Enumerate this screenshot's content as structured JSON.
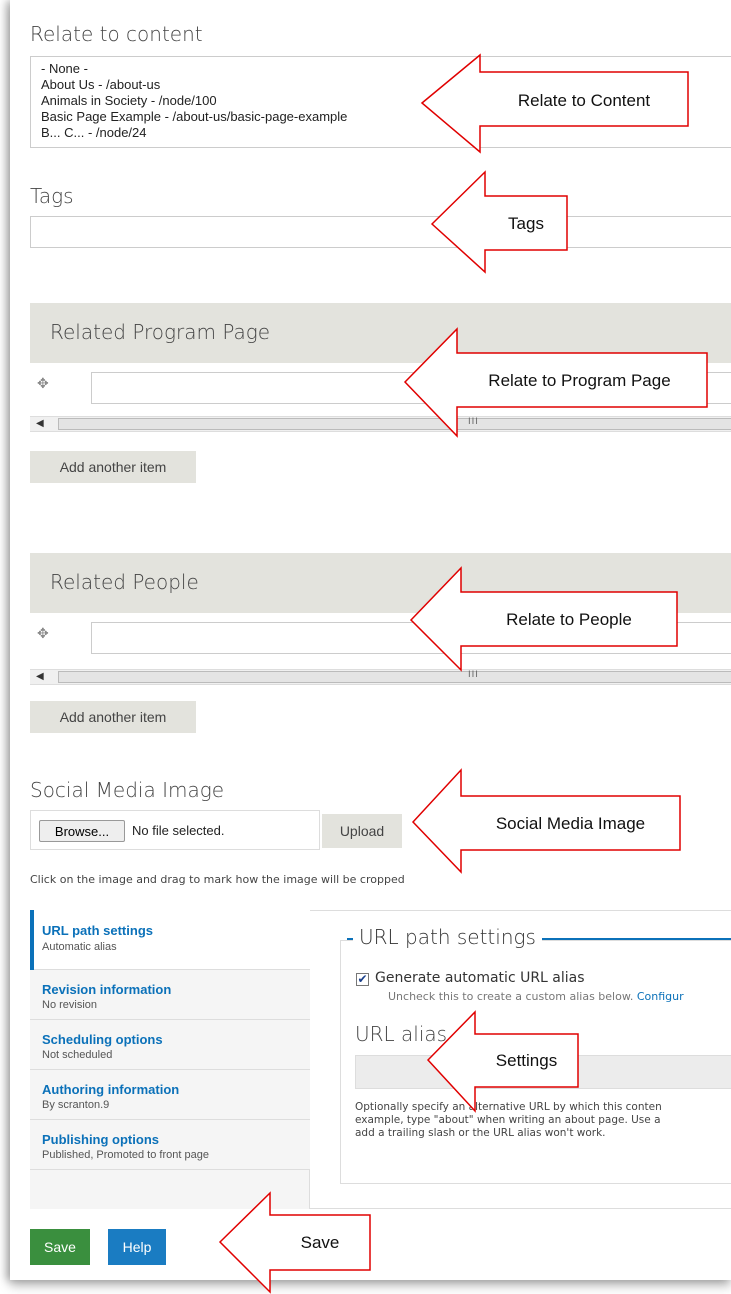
{
  "relate": {
    "label": "Relate to content",
    "options": [
      "- None -",
      "About Us - /about-us",
      "Animals in Society - /node/100",
      "Basic Page Example - /about-us/basic-page-example",
      "B... C... - /node/24"
    ]
  },
  "tags": {
    "label": "Tags",
    "value": ""
  },
  "program": {
    "title": "Related Program Page",
    "add_label": "Add another item",
    "value": ""
  },
  "people": {
    "title": "Related People",
    "add_label": "Add another item",
    "value": ""
  },
  "social": {
    "label": "Social Media Image",
    "browse_label": "Browse...",
    "file_status": "No file selected.",
    "upload_label": "Upload",
    "help": "Click on the image and drag to mark how the image will be cropped"
  },
  "vtabs": [
    {
      "title": "URL path settings",
      "summary": "Automatic alias",
      "active": true
    },
    {
      "title": "Revision information",
      "summary": "No revision",
      "active": false
    },
    {
      "title": "Scheduling options",
      "summary": "Not scheduled",
      "active": false
    },
    {
      "title": "Authoring information",
      "summary": "By scranton.9",
      "active": false
    },
    {
      "title": "Publishing options",
      "summary": "Published, Promoted to front page",
      "active": false
    }
  ],
  "url_panel": {
    "legend": "URL path settings",
    "checkbox_label": "Generate automatic URL alias",
    "checkbox_checked": true,
    "checkbox_desc": "Uncheck this to create a custom alias below.",
    "configure_link": "Configur",
    "alias_label": "URL alias",
    "alias_value": "",
    "alias_desc_1": "Optionally specify an alternative URL by which this conten",
    "alias_desc_2": "example, type \"about\" when writing an about page. Use a",
    "alias_desc_3": "add a trailing slash or the URL alias won't work."
  },
  "actions": {
    "save_label": "Save",
    "help_label": "Help"
  },
  "callouts": {
    "relate": "Relate to Content",
    "tags": "Tags",
    "program": "Relate to Program Page",
    "people": "Relate to People",
    "social": "Social Media Image",
    "settings": "Settings",
    "save": "Save"
  },
  "colors": {
    "accent_blue": "#0b71b9",
    "save_green": "#3a8f3e",
    "help_blue": "#1a7cc2",
    "section_grey": "#e3e3dd",
    "callout_red": "#e00000"
  }
}
